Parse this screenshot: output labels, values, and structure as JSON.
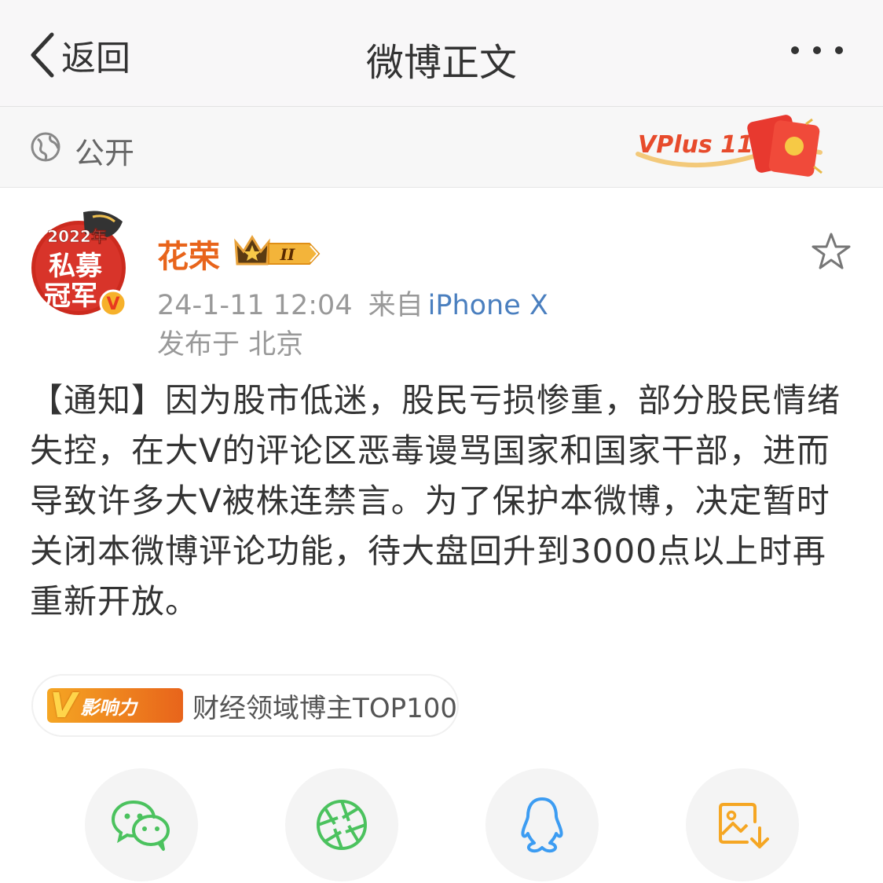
{
  "nav": {
    "back_label": "返回",
    "title": "微博正文",
    "more_icon": "more-dots-icon"
  },
  "visibility": {
    "label": "公开",
    "icon": "globe-icon"
  },
  "promo": {
    "text": "VPlus 11·11"
  },
  "post": {
    "author": {
      "name": "花荣",
      "name_color": "#e8641b",
      "avatar_lines": [
        "2022年",
        "私募",
        "冠军"
      ],
      "verified_mark": "V",
      "level": "II"
    },
    "time": "24-1-11 12:04",
    "source_prefix": "来自",
    "device": "iPhone X",
    "location": "发布于 北京",
    "content": "【通知】因为股市低迷，股民亏损惨重，部分股民情绪失控，在大V的评论区恶毒谩骂国家和国家干部，进而导致许多大V被株连禁言。为了保护本微博，决定暂时关闭本微博评论功能，待大盘回升到3000点以上时再重新开放。",
    "influence_badge": {
      "icon_letter": "V",
      "tag_label": "影响力",
      "text": "财经领域博主TOP100"
    }
  },
  "share_buttons": [
    {
      "icon": "wechat-icon",
      "color": "#4bc25e"
    },
    {
      "icon": "moments-icon",
      "color": "#4bc25e"
    },
    {
      "icon": "qq-icon",
      "color": "#3c9cf2"
    },
    {
      "icon": "save-image-icon",
      "color": "#f5a623"
    }
  ],
  "colors": {
    "accent_orange": "#e8641b",
    "link_blue": "#4a7fbf",
    "meta_gray": "#999999"
  }
}
